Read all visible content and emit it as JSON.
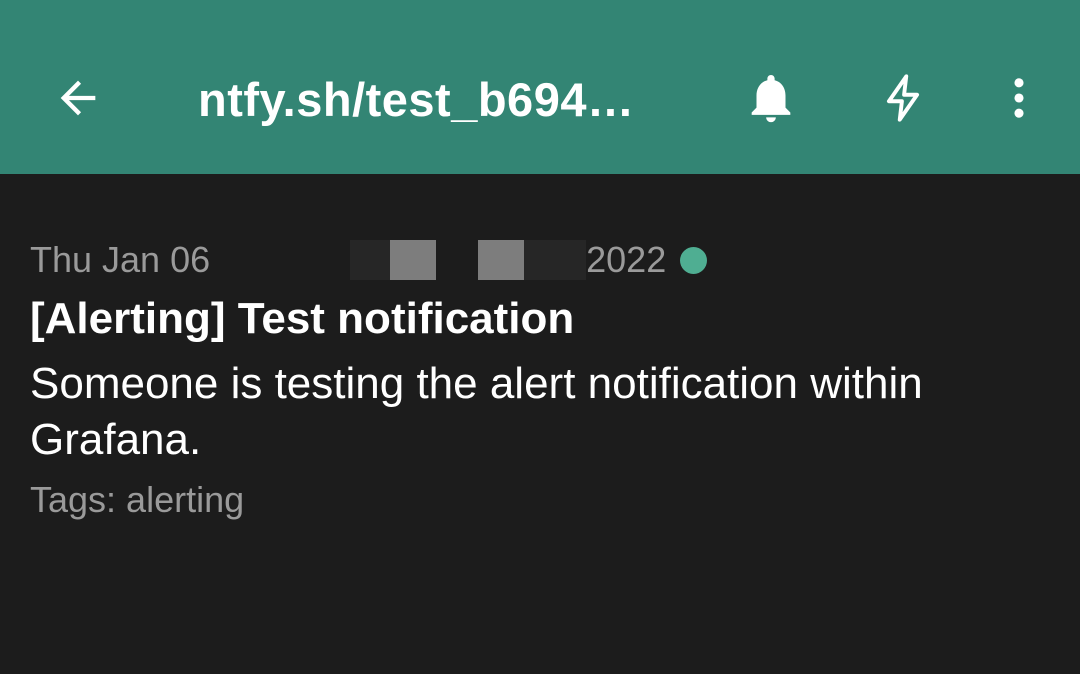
{
  "toolbar": {
    "back_icon": "arrow-left-icon",
    "title": "ntfy.sh/test_b694…",
    "bell_icon": "bell-icon",
    "bolt_icon": "lightning-bolt-icon",
    "more_icon": "more-vertical-icon",
    "background_color": "#338574"
  },
  "notification": {
    "date_prefix": "Thu Jan 06",
    "date_suffix": "2022",
    "unread_dot_color": "#4fae92",
    "title": "[Alerting] Test notification",
    "message": "Someone is testing the alert notification within Grafana.",
    "tags": "Tags: alerting"
  }
}
